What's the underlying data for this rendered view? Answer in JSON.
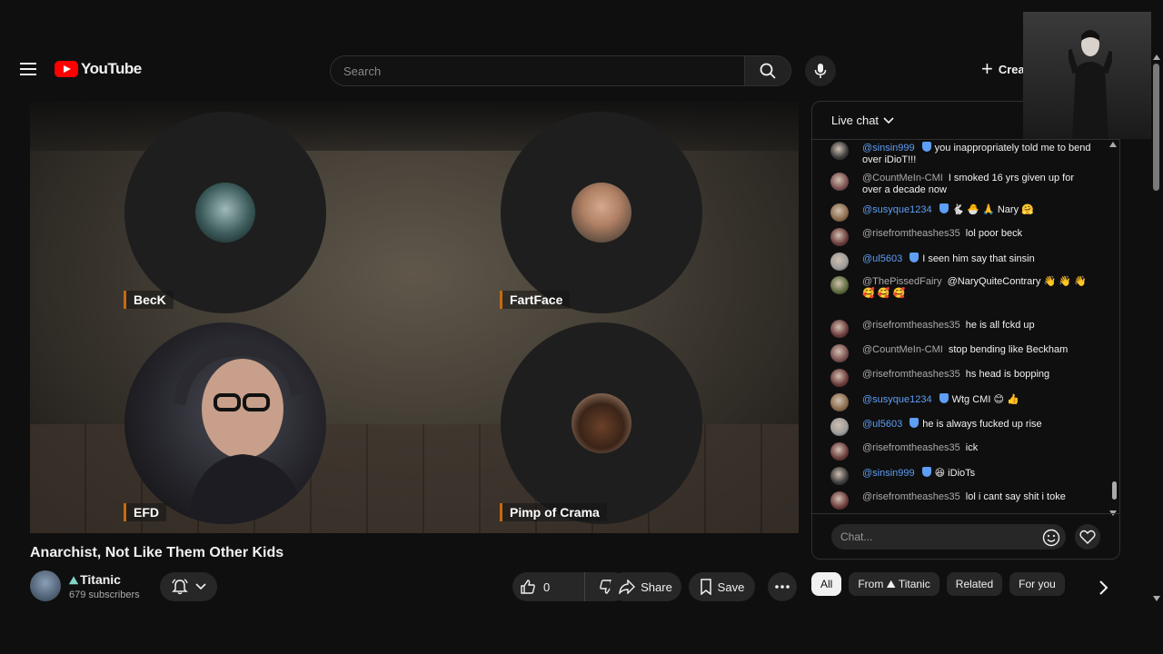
{
  "header": {
    "logo_text": "YouTube",
    "search_placeholder": "Search",
    "create_label": "Create"
  },
  "video": {
    "participants": [
      {
        "name": "BecK"
      },
      {
        "name": "FartFace"
      },
      {
        "name": "EFD"
      },
      {
        "name": "Pimp of Crama"
      }
    ]
  },
  "meta": {
    "title": "Anarchist, Not Like Them Other Kids",
    "channel_name": "Titanic",
    "channel_emoji": "⛰",
    "subscribers": "679 subscribers",
    "likes": "0",
    "share_label": "Share",
    "save_label": "Save"
  },
  "chat": {
    "header": "Live chat",
    "input_placeholder": "Chat...",
    "messages": [
      {
        "author": "@sinsin999",
        "verified": true,
        "text": "you inappropriately told me to bend over iDioT!!!",
        "color": "#5e9ef5"
      },
      {
        "author": "@CountMeIn-CMI",
        "verified": false,
        "text": "I smoked 16 yrs given up for over a decade now",
        "color": "#aaaaaa"
      },
      {
        "author": "@susyque1234",
        "verified": true,
        "text": "🐇 🐣 🙏 Nary 🤗",
        "color": "#5e9ef5"
      },
      {
        "author": "@risefromtheashes35",
        "verified": false,
        "text": "lol poor beck",
        "color": "#aaaaaa"
      },
      {
        "author": "@ul5603",
        "verified": true,
        "text": "I seen him say that sinsin",
        "color": "#5e9ef5"
      },
      {
        "author": "@ThePissedFairy",
        "verified": false,
        "text": "@NaryQuiteContrary 👋 👋 👋 🥰 🥰 🥰",
        "color": "#aaaaaa"
      },
      {
        "author": "@risefromtheashes35",
        "verified": false,
        "text": "he is all fckd up",
        "color": "#aaaaaa"
      },
      {
        "author": "@CountMeIn-CMI",
        "verified": false,
        "text": "stop bending like Beckham",
        "color": "#aaaaaa"
      },
      {
        "author": "@risefromtheashes35",
        "verified": false,
        "text": "hs head is bopping",
        "color": "#aaaaaa"
      },
      {
        "author": "@susyque1234",
        "verified": true,
        "text": "Wtg CMI 😊 👍",
        "color": "#5e9ef5"
      },
      {
        "author": "@ul5603",
        "verified": true,
        "text": "he is always fucked up rise",
        "color": "#5e9ef5"
      },
      {
        "author": "@risefromtheashes35",
        "verified": false,
        "text": "ick",
        "color": "#aaaaaa"
      },
      {
        "author": "@sinsin999",
        "verified": true,
        "text": "😆 iDioTs",
        "color": "#5e9ef5"
      },
      {
        "author": "@risefromtheashes35",
        "verified": false,
        "text": "lol i cant say shit i toke",
        "color": "#aaaaaa"
      }
    ]
  },
  "chips": [
    "All",
    "From ⛰ Titanic",
    "Related",
    "For you"
  ],
  "colors": {
    "background": "#0f0f0f",
    "brand_red": "#ff0000",
    "verified_blue": "#5e9ef5",
    "label_accent": "#c46a12"
  }
}
